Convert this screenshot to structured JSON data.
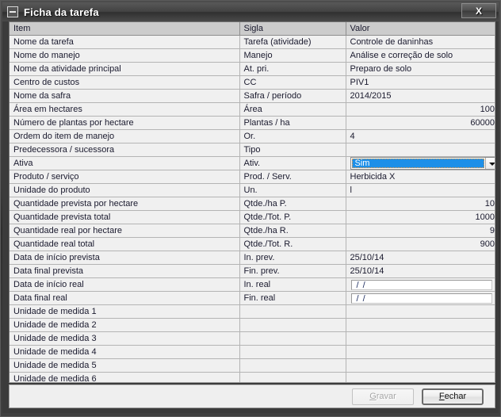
{
  "window": {
    "title": "Ficha da tarefa",
    "sysmenu_icon": "minimize-box-icon",
    "close_label": "X"
  },
  "grid": {
    "headers": [
      "Item",
      "Sigla",
      "Valor"
    ],
    "rows": [
      {
        "item": "Nome da tarefa",
        "sigla": "Tarefa (atividade)",
        "valor": "Controle de daninhas",
        "type": "text",
        "align": "left"
      },
      {
        "item": "Nome do manejo",
        "sigla": "Manejo",
        "valor": "Análise e correção de solo",
        "type": "text",
        "align": "left"
      },
      {
        "item": "Nome da atividade principal",
        "sigla": "At. pri.",
        "valor": "Preparo de solo",
        "type": "text",
        "align": "left"
      },
      {
        "item": "Centro de custos",
        "sigla": "CC",
        "valor": "PIV1",
        "type": "text",
        "align": "left"
      },
      {
        "item": "Nome da safra",
        "sigla": "Safra / período",
        "valor": "2014/2015",
        "type": "text",
        "align": "left"
      },
      {
        "item": "Área em hectares",
        "sigla": "Área",
        "valor": "100",
        "type": "text",
        "align": "right"
      },
      {
        "item": "Número de plantas por hectare",
        "sigla": "Plantas / ha",
        "valor": "60000",
        "type": "text",
        "align": "right"
      },
      {
        "item": "Ordem do item de manejo",
        "sigla": "Or.",
        "valor": "4",
        "type": "text",
        "align": "left"
      },
      {
        "item": "Predecessora / sucessora",
        "sigla": "Tipo",
        "valor": "",
        "type": "text",
        "align": "left"
      },
      {
        "item": "Ativa",
        "sigla": "Ativ.",
        "valor": "Sim",
        "type": "combo",
        "align": "left"
      },
      {
        "item": "Produto / serviço",
        "sigla": "Prod. / Serv.",
        "valor": "Herbicida X",
        "type": "text",
        "align": "left"
      },
      {
        "item": "Unidade do produto",
        "sigla": "Un.",
        "valor": "l",
        "type": "text",
        "align": "left"
      },
      {
        "item": "Quantidade prevista por hectare",
        "sigla": "Qtde./ha P.",
        "valor": "10",
        "type": "text",
        "align": "right"
      },
      {
        "item": "Quantidade prevista total",
        "sigla": "Qtde./Tot. P.",
        "valor": "1000",
        "type": "text",
        "align": "right"
      },
      {
        "item": "Quantidade real por hectare",
        "sigla": "Qtde./ha R.",
        "valor": "9",
        "type": "editable",
        "align": "right"
      },
      {
        "item": "Quantidade real total",
        "sigla": "Qtde./Tot. R.",
        "valor": "900",
        "type": "editable",
        "align": "right"
      },
      {
        "item": "Data de início prevista",
        "sigla": "In. prev.",
        "valor": "25/10/14",
        "type": "text",
        "align": "left"
      },
      {
        "item": "Data final prevista",
        "sigla": "Fin. prev.",
        "valor": "25/10/14",
        "type": "text",
        "align": "left"
      },
      {
        "item": "Data de início real",
        "sigla": "In. real",
        "valor": "/  /",
        "type": "date",
        "align": "left"
      },
      {
        "item": "Data final real",
        "sigla": "Fin. real",
        "valor": "/  /",
        "type": "date",
        "align": "left"
      },
      {
        "item": "Unidade de medida 1",
        "sigla": "",
        "valor": "",
        "type": "text",
        "align": "left"
      },
      {
        "item": "Unidade de medida 2",
        "sigla": "",
        "valor": "",
        "type": "text",
        "align": "left"
      },
      {
        "item": "Unidade de medida 3",
        "sigla": "",
        "valor": "",
        "type": "text",
        "align": "left"
      },
      {
        "item": "Unidade de medida 4",
        "sigla": "",
        "valor": "",
        "type": "text",
        "align": "left"
      },
      {
        "item": "Unidade de medida 5",
        "sigla": "",
        "valor": "",
        "type": "text",
        "align": "left"
      },
      {
        "item": "Unidade de medida 6",
        "sigla": "",
        "valor": "",
        "type": "text",
        "align": "left"
      }
    ]
  },
  "buttons": {
    "save": {
      "label_before": "",
      "accel": "G",
      "label_after": "ravar",
      "enabled": false
    },
    "close": {
      "label_before": "",
      "accel": "F",
      "label_after": "echar",
      "enabled": true
    }
  },
  "colors": {
    "selection_blue": "#1d8fe8",
    "header_gray": "#cccccc",
    "row_gray": "#f0f0f0",
    "editable_white": "#ffffff"
  }
}
